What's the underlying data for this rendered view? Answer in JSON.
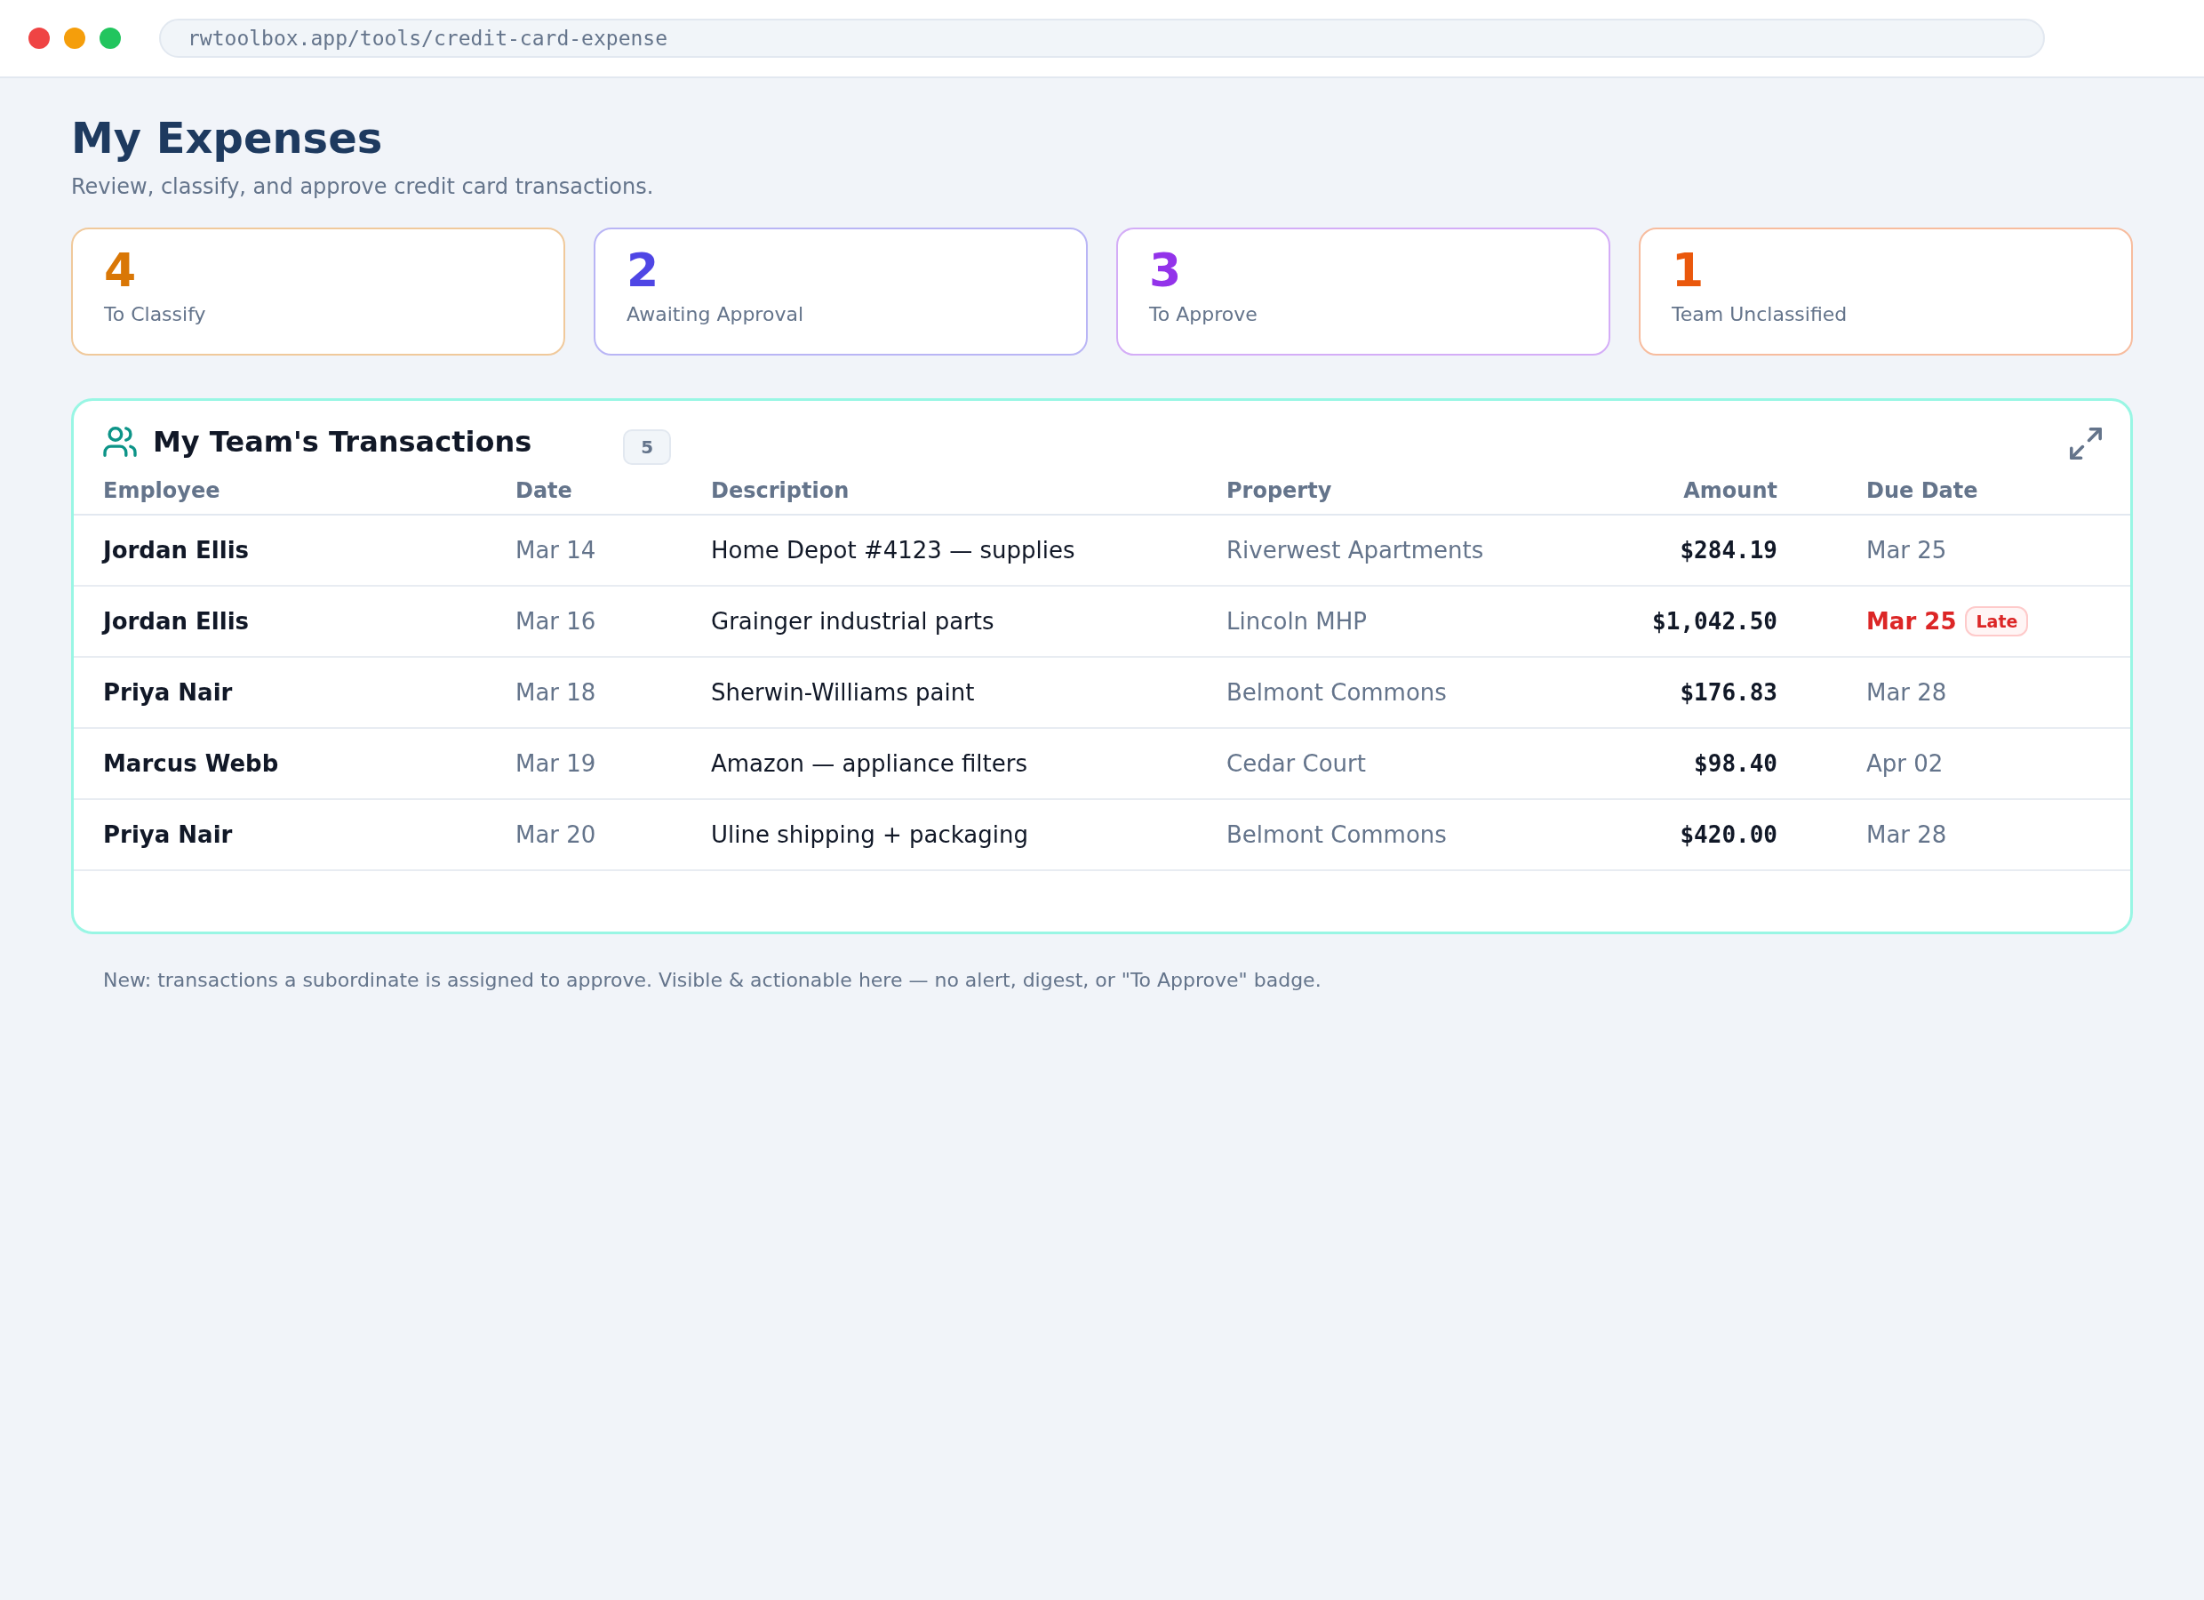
{
  "browser": {
    "url": "rwtoolbox.app/tools/credit-card-expense"
  },
  "header": {
    "title": "My Expenses",
    "subtitle": "Review, classify, and approve credit card transactions."
  },
  "stats": [
    {
      "value": "4",
      "label": "To Classify",
      "color": "#d97706"
    },
    {
      "value": "2",
      "label": "Awaiting Approval",
      "color": "#4f46e5"
    },
    {
      "value": "3",
      "label": "To Approve",
      "color": "#9333ea"
    },
    {
      "value": "1",
      "label": "Team Unclassified",
      "color": "#ea580c"
    }
  ],
  "team_transactions": {
    "title": "My Team's Transactions",
    "count": "5",
    "columns": [
      "Employee",
      "Date",
      "Description",
      "Property",
      "Amount",
      "Due Date"
    ],
    "rows": [
      {
        "employee": "Jordan Ellis",
        "date": "Mar 14",
        "description": "Home Depot #4123 — supplies",
        "property": "Riverwest Apartments",
        "amount": "$284.19",
        "due_date": "Mar 25",
        "late": false
      },
      {
        "employee": "Jordan Ellis",
        "date": "Mar 16",
        "description": "Grainger industrial parts",
        "property": "Lincoln MHP",
        "amount": "$1,042.50",
        "due_date": "Mar 25",
        "late": true,
        "due_badge": "Late"
      },
      {
        "employee": "Priya Nair",
        "date": "Mar 18",
        "description": "Sherwin-Williams paint",
        "property": "Belmont Commons",
        "amount": "$176.83",
        "due_date": "Mar 28",
        "late": false
      },
      {
        "employee": "Marcus Webb",
        "date": "Mar 19",
        "description": "Amazon — appliance filters",
        "property": "Cedar Court",
        "amount": "$98.40",
        "due_date": "Apr 02",
        "late": false
      },
      {
        "employee": "Priya Nair",
        "date": "Mar 20",
        "description": "Uline shipping + packaging",
        "property": "Belmont Commons",
        "amount": "$420.00",
        "due_date": "Mar 28",
        "late": false
      }
    ]
  },
  "note": "New: transactions a subordinate is assigned to approve. Visible & actionable here — no alert, digest, or \"To Approve\" badge."
}
